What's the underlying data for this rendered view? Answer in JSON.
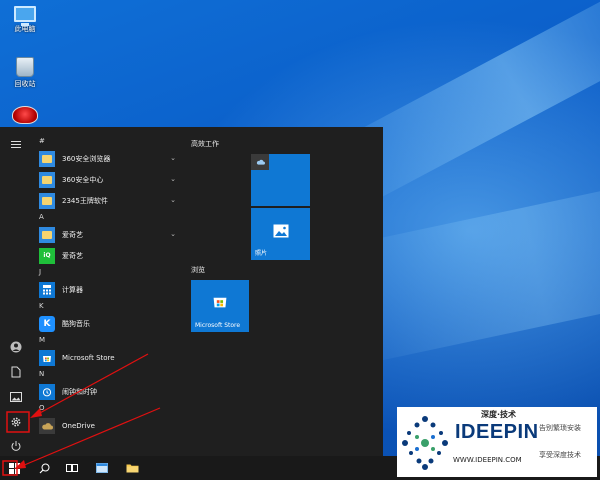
{
  "desktop": {
    "icons": [
      {
        "label": "此电脑",
        "icon": "this-pc-icon"
      },
      {
        "label": "回收站",
        "icon": "recycle-bin-icon"
      },
      {
        "label": "",
        "icon": "360-security-icon"
      }
    ]
  },
  "start_menu": {
    "rail": [
      {
        "name": "menu",
        "icon": "hamburger-icon"
      },
      {
        "name": "account",
        "icon": "user-icon"
      },
      {
        "name": "documents",
        "icon": "document-icon"
      },
      {
        "name": "pictures",
        "icon": "pictures-icon"
      },
      {
        "name": "settings",
        "icon": "gear-icon"
      },
      {
        "name": "power",
        "icon": "power-icon"
      }
    ],
    "app_list": [
      {
        "group": "#"
      },
      {
        "label": "360安全浏览器",
        "icon": "folder-icon",
        "expandable": true
      },
      {
        "label": "360安全中心",
        "icon": "folder-icon",
        "expandable": true
      },
      {
        "label": "2345王牌软件",
        "icon": "folder-icon",
        "expandable": true
      },
      {
        "group": "A"
      },
      {
        "label": "爱奇艺",
        "icon": "folder-icon",
        "expandable": true
      },
      {
        "label": "爱奇艺",
        "icon": "iqiyi-icon",
        "expandable": false
      },
      {
        "group": "J"
      },
      {
        "label": "计算器",
        "icon": "calculator-icon",
        "expandable": false
      },
      {
        "group": "K"
      },
      {
        "label": "酷狗音乐",
        "icon": "kugou-icon",
        "expandable": false
      },
      {
        "group": "M"
      },
      {
        "label": "Microsoft Store",
        "icon": "store-icon",
        "expandable": false
      },
      {
        "group": "N"
      },
      {
        "label": "闹钟和时钟",
        "icon": "alarm-clock-icon",
        "expandable": false
      },
      {
        "group": "O"
      },
      {
        "label": "OneDrive",
        "icon": "onedrive-icon",
        "expandable": false
      }
    ],
    "tiles": {
      "section1_title": "高效工作",
      "section2_title": "浏览",
      "photos_label": "照片",
      "store_label": "Microsoft Store"
    }
  },
  "taskbar": {
    "items": [
      "start-button-icon",
      "search-icon",
      "task-view-icon",
      "file-explorer-icon"
    ]
  },
  "watermark": {
    "title": "深度·技术",
    "brand": "IDEEPIN",
    "url": "WWW.IDEEPIN.COM",
    "slogan1": "告别繁琐安装",
    "slogan2": "享受深度技术"
  },
  "colors": {
    "accent": "#0f78d4",
    "menu_bg": "#1f1f1f",
    "taskbar_bg": "#191919",
    "annotation": "#e01010"
  }
}
